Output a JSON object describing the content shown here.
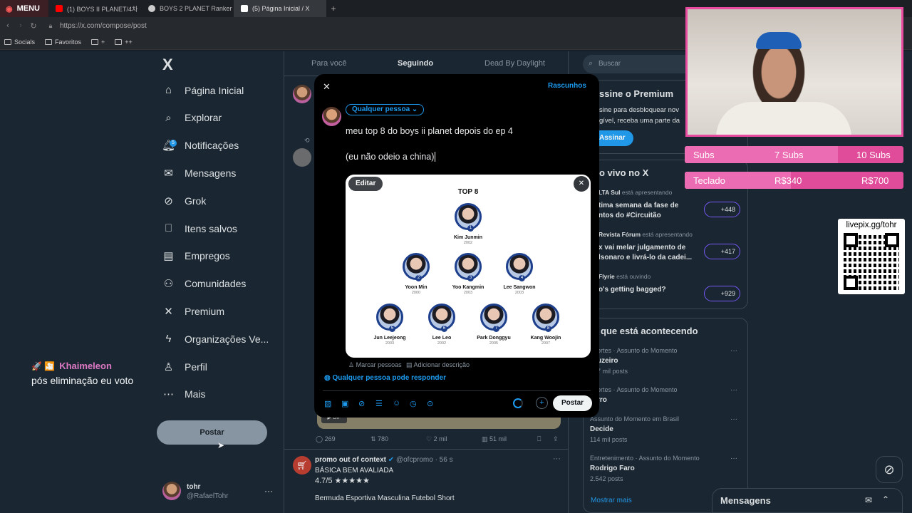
{
  "browser": {
    "menu_label": "MENU",
    "tabs": [
      {
        "label": "(1) BOYS II PLANET/4차",
        "icon_color": "#ff0000"
      },
      {
        "label": "BOYS 2 PLANET Ranker",
        "icon_color": "#cccccc"
      },
      {
        "label": "(5) Página Inicial / X",
        "icon_color": "#ffffff"
      }
    ],
    "new_tab": "+",
    "url": "https://x.com/compose/post",
    "bookmarks": [
      "Socials",
      "Favoritos",
      "+",
      "++"
    ]
  },
  "sidebar": {
    "logo": "X",
    "items": [
      {
        "label": "Página Inicial",
        "icon": "home-icon",
        "glyph": "⌂"
      },
      {
        "label": "Explorar",
        "icon": "search-icon",
        "glyph": "⌕"
      },
      {
        "label": "Notificações",
        "icon": "bell-icon",
        "glyph": "🔔︎",
        "badge": "5"
      },
      {
        "label": "Mensagens",
        "icon": "mail-icon",
        "glyph": "✉"
      },
      {
        "label": "Grok",
        "icon": "grok-icon",
        "glyph": "⊘"
      },
      {
        "label": "Itens salvos",
        "icon": "bookmark-icon",
        "glyph": "⎕"
      },
      {
        "label": "Empregos",
        "icon": "briefcase-icon",
        "glyph": "▤"
      },
      {
        "label": "Comunidades",
        "icon": "people-icon",
        "glyph": "⚇"
      },
      {
        "label": "Premium",
        "icon": "x-logo-icon",
        "glyph": "✕"
      },
      {
        "label": "Organizações Ve...",
        "icon": "lightning-icon",
        "glyph": "ϟ"
      },
      {
        "label": "Perfil",
        "icon": "person-icon",
        "glyph": "♙"
      },
      {
        "label": "Mais",
        "icon": "more-circle-icon",
        "glyph": "⋯"
      }
    ],
    "post_button": "Postar",
    "account": {
      "name": "tohr",
      "handle": "@RafaelTohr",
      "more": "···"
    }
  },
  "stream_overlay": {
    "follower_icons": "🚀 🎦",
    "follower_name": "Khaimeleon",
    "follower_msg": "pós eliminação eu voto",
    "subs_label": "Subs",
    "subs_current": "7 Subs",
    "subs_goal": "10 Subs",
    "teclado_label": "Teclado",
    "teclado_current": "R$340",
    "teclado_goal": "R$700",
    "livepix": "livepix.gg/tohr"
  },
  "timeline": {
    "tabs": [
      "Para você",
      "Seguindo",
      "Dead By Daylight"
    ],
    "post_stats": {
      "replies": "269",
      "reposts": "780",
      "likes": "2 mil",
      "views": "51 mil"
    },
    "gif_label": "GIF",
    "tweet": {
      "author": "promo out of context",
      "handle": "@ofcpromo",
      "time": "· 56 s",
      "line1": "BÁSICA BEM AVALIADA",
      "rating": "4.7/5 ★★★★★",
      "line3": "Bermuda Esportiva Masculina Futebol Short"
    }
  },
  "right": {
    "search_placeholder": "Buscar",
    "premium": {
      "title": "ssine o Premium",
      "text1": "sine para desbloquear nov",
      "text2": "gível, receba uma parte da",
      "button": "Assinar"
    },
    "live": {
      "title": "o vivo no X",
      "items": [
        {
          "host": "LTA Sul",
          "status": "está apresentando",
          "title1": "tima semana da fase de",
          "title2": "ntos do #Circuitão",
          "count": "+448"
        },
        {
          "host": "Revista Fórum",
          "status": "está apresentando",
          "title1": "x vai melar julgamento de",
          "title2": "lsonaro e livrá-lo da cadei...",
          "count": "+417"
        },
        {
          "host": "Flyrie",
          "status": "está ouvindo",
          "title1": "o's getting bagged?",
          "title2": "",
          "count": "+929"
        }
      ]
    },
    "trends": {
      "title": "que está acontecendo",
      "items": [
        {
          "meta": "ortes · Assunto do Momento",
          "name": "uzeiro",
          "posts": "7 mil posts"
        },
        {
          "meta": "ortes · Assunto do Momento",
          "name": "rro",
          "posts": ""
        },
        {
          "meta": "Assunto do Momento em Brasil",
          "name": "Decide",
          "posts": "114 mil posts"
        },
        {
          "meta": "Entretenimento · Assunto do Momento",
          "name": "Rodrigo Faro",
          "posts": "2.542 posts"
        }
      ],
      "more": "Mostrar mais"
    },
    "messages_dock": "Mensagens"
  },
  "compose": {
    "close": "✕",
    "drafts": "Rascunhos",
    "audience": "Qualquer pessoa",
    "text_line1": "meu top 8 do boys ii planet depois do ep 4",
    "text_line2": "(eu não odeio a china)",
    "edit_button": "Editar",
    "tag_people": "Marcar pessoas",
    "add_description": "Adicionar descrição",
    "reply_setting": "Qualquer pessoa pode responder",
    "post_button": "Postar"
  },
  "image": {
    "title": "TOP 8",
    "people": [
      {
        "num": "1",
        "name": "Kim Junmin",
        "year": "2002"
      },
      {
        "num": "2",
        "name": "Yoon Min",
        "year": "2000"
      },
      {
        "num": "3",
        "name": "Yoo Kangmin",
        "year": "2003"
      },
      {
        "num": "4",
        "name": "Lee Sangwon",
        "year": "2003"
      },
      {
        "num": "5",
        "name": "Jun Leejeong",
        "year": "2003"
      },
      {
        "num": "6",
        "name": "Lee Leo",
        "year": "2002"
      },
      {
        "num": "7",
        "name": "Park Donggyu",
        "year": "2005"
      },
      {
        "num": "8",
        "name": "Kang Woojin",
        "year": "2007"
      }
    ]
  }
}
